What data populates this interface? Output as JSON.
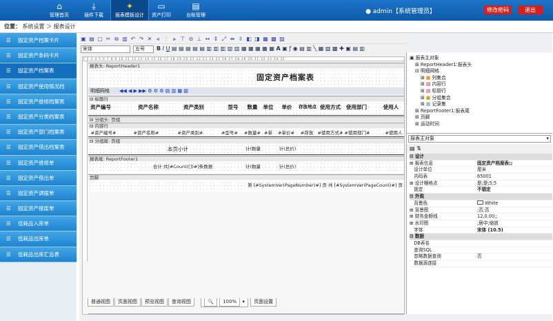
{
  "topnav": {
    "items": [
      "管理首页",
      "插件下载",
      "报表模板设计",
      "资产打印",
      "台账管理"
    ],
    "user": "admin【系统管理员】",
    "change_pwd": "修改密码",
    "logout": "退出"
  },
  "breadcrumb": {
    "label": "位置：",
    "path": "系统设置 ＞ 报表设计"
  },
  "sidebar": {
    "items": [
      "固定资产档案卡片",
      "固定资产条码卡片",
      "固定资产档案表",
      "固定资产使用情况档",
      "固定资产维修档案表",
      "固定资产分类档案表",
      "固定资产部门档案表",
      "固定资产借出档案表",
      "固定资产维修单",
      "固定资产借出单",
      "固定资产调拨单",
      "固定资产报废单",
      "低耗品入库单",
      "低耗品出库单",
      "低耗品出库汇总表"
    ]
  },
  "toolbar": {
    "font": "宋体",
    "size": "五号"
  },
  "designer": {
    "header_band": "报表头: ReportHeader1",
    "report_title": "固定资产档案表",
    "grid_title": "明细网格",
    "col_band": "标题行",
    "group1": "分组头: 页组",
    "content_band": "内容行",
    "group2": "分组尾: 页组",
    "footer_band": "报表尾: ReportFooter1",
    "page_footer": "页脚",
    "headers": [
      "资产编号",
      "资产名称",
      "资产类别",
      "型号",
      "数量",
      "单位",
      "单价",
      "存放地点",
      "使用方式",
      "使用部门",
      "使用人"
    ],
    "fields": [
      "#资产编号#",
      "#资产名称#",
      "#资产类别#",
      "#型号#",
      "#数量#",
      "#单",
      "#单价#",
      "#存放",
      "#使用方式#",
      "#使用部门#",
      "#使用人"
    ],
    "subtotal": "本页小计",
    "subtotal_qty": "计(数量",
    "subtotal_amt": "计(总价)",
    "total_label": "合计   共[#Count([])#]条数据",
    "total_qty": "计(数量",
    "total_amt": "计(总价)",
    "pager": "第 [#SystemVar(PageNumber)#] 页 共 [#SystemVar(PageCount)#] 页",
    "tabs": [
      "普通视图",
      "页面视图",
      "预览视图",
      "查询视图"
    ],
    "zoom": "100%",
    "page_setup": "页面设置"
  },
  "tree": [
    "报表主对象",
    "ReportHeader1:报表头",
    "明细网格",
    "列集合",
    "内容行",
    "标题行",
    "分组集合",
    "记录集",
    "ReportFooter1:报表尾",
    "页脚",
    "运动时间"
  ],
  "props": {
    "object": "报表主对象",
    "rows": [
      {
        "k": "设计",
        "v": "",
        "cat": true
      },
      {
        "k": "报表信息",
        "v": "固定资产档案表;;"
      },
      {
        "k": "设计单位",
        "v": "厘米"
      },
      {
        "k": "内码表",
        "v": "65001"
      },
      {
        "k": "设计栅格点",
        "v": "是;是;5;5"
      },
      {
        "k": "锁定",
        "v": "不锁定"
      },
      {
        "k": "外观",
        "v": "",
        "cat": true
      },
      {
        "k": "背景色",
        "v": "White"
      },
      {
        "k": "背景图",
        "v": ";否;否"
      },
      {
        "k": "财务金额线",
        "v": "12,0.00;;"
      },
      {
        "k": "水印图",
        "v": ";居中;缩放"
      },
      {
        "k": "字体",
        "v": "宋体 (10.5)"
      },
      {
        "k": "数据",
        "v": "",
        "cat": true
      },
      {
        "k": "DB表名",
        "v": ""
      },
      {
        "k": "查询SQL",
        "v": ""
      },
      {
        "k": "忽略数据查询",
        "v": "否"
      },
      {
        "k": "数据源连接",
        "v": ""
      }
    ]
  }
}
